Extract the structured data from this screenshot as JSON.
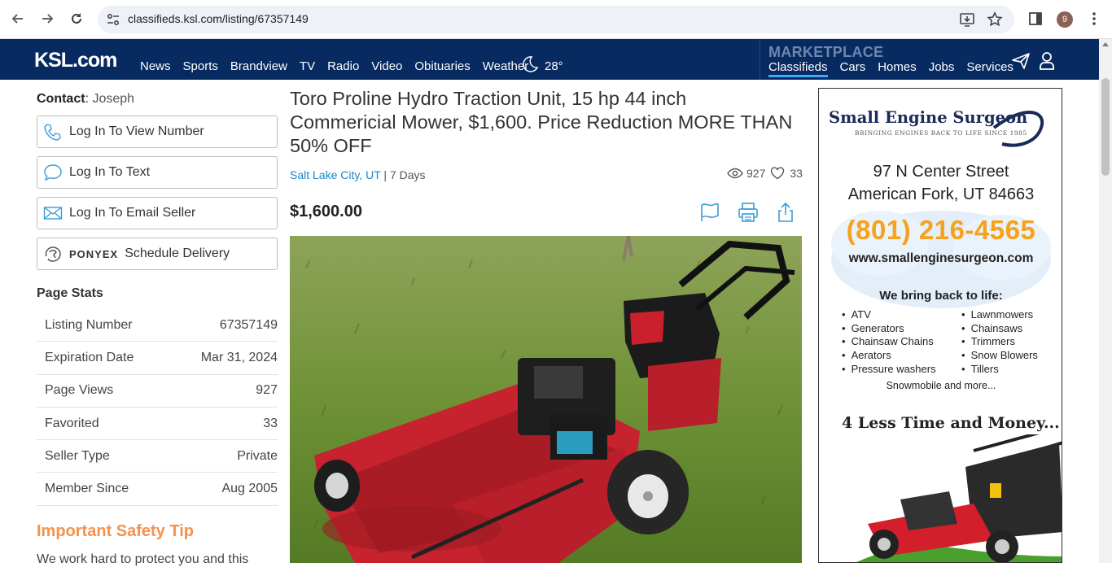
{
  "browser": {
    "url": "classifieds.ksl.com/listing/67357149",
    "profile_initial": "9"
  },
  "header": {
    "logo": "KSL.com",
    "nav": [
      "News",
      "Sports",
      "Brandview",
      "TV",
      "Radio",
      "Video",
      "Obituaries",
      "Weather"
    ],
    "temperature": "28°",
    "marketplace_label": "MARKETPLACE",
    "marketplace_nav": [
      "Classifieds",
      "Cars",
      "Homes",
      "Jobs",
      "Services"
    ],
    "active_section": "Classifieds"
  },
  "contact": {
    "label": "Contact",
    "name": "Joseph",
    "buttons": {
      "view_number": "Log In To View Number",
      "text": "Log In To Text",
      "email": "Log In To Email Seller",
      "ponyex_brand": "PONYEX",
      "delivery": "Schedule Delivery"
    }
  },
  "page_stats": {
    "title": "Page Stats",
    "rows": [
      {
        "label": "Listing Number",
        "value": "67357149"
      },
      {
        "label": "Expiration Date",
        "value": "Mar 31, 2024"
      },
      {
        "label": "Page Views",
        "value": "927"
      },
      {
        "label": "Favorited",
        "value": "33"
      },
      {
        "label": "Seller Type",
        "value": "Private"
      },
      {
        "label": "Member Since",
        "value": "Aug 2005"
      }
    ]
  },
  "safety": {
    "title": "Important Safety Tip",
    "text": "We work hard to protect you and this"
  },
  "listing": {
    "title": "Toro Proline Hydro Traction Unit, 15 hp 44 inch Commericial Mower, $1,600. Price Reduction MORE THAN 50% OFF",
    "city": "Salt Lake City, UT",
    "age": "| 7 Days",
    "views": "927",
    "favorites": "33",
    "price": "$1,600.00"
  },
  "ad": {
    "brand": "Small Engine Surgeon",
    "slogan": "BRINGING ENGINES BACK TO LIFE SINCE 1985",
    "address_line1": "97 N Center Street",
    "address_line2": "American Fork, UT 84663",
    "phone": "(801) 216-4565",
    "website": "www.smallenginesurgeon.com",
    "bring_back": "We bring back to life:",
    "list_left": [
      "ATV",
      "Generators",
      "Chainsaw Chains",
      "Aerators",
      "Pressure washers"
    ],
    "list_right": [
      "Lawnmowers",
      "Chainsaws",
      "Trimmers",
      "Snow Blowers",
      "Tillers"
    ],
    "more": "Snowmobile and more...",
    "tagline": "4 Less Time and Money..."
  },
  "colors": {
    "header_bg": "#072a61",
    "link_blue": "#1a85c7",
    "safety_orange": "#f5924b",
    "phone_orange": "#f6a21b",
    "active_underline": "#3ea8ff"
  }
}
